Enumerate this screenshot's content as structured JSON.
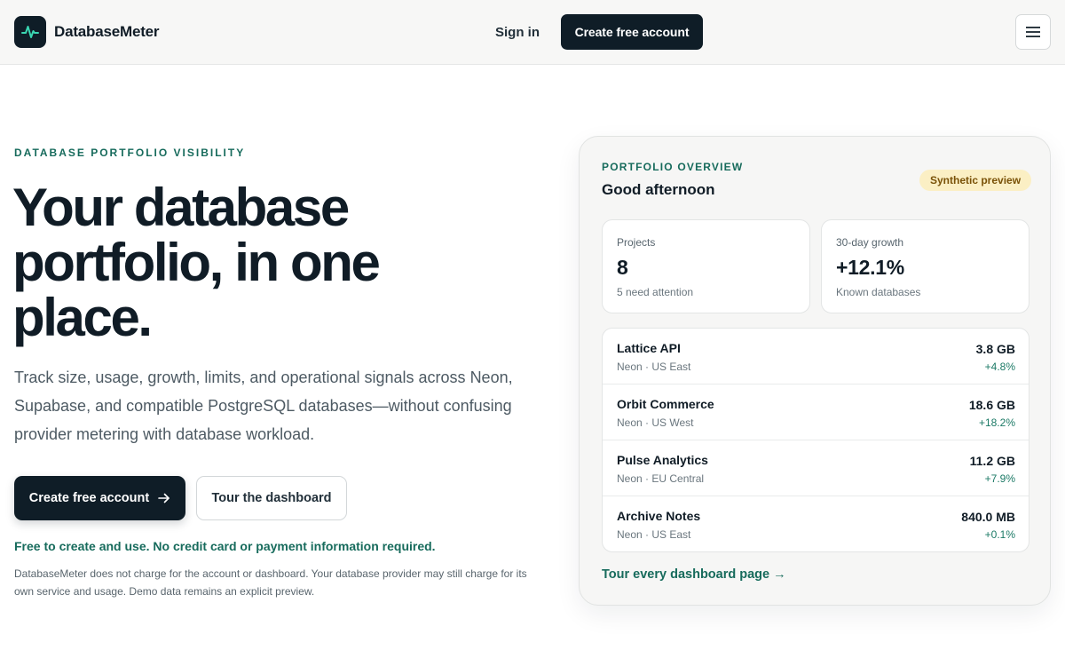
{
  "header": {
    "brand": "DatabaseMeter",
    "logo_icon": "pulse-icon",
    "signin_label": "Sign in",
    "cta_label": "Create free account",
    "menu_icon": "hamburger-icon"
  },
  "hero": {
    "eyebrow": "DATABASE PORTFOLIO VISIBILITY",
    "title": "Your database portfolio, in one place.",
    "description": "Track size, usage, growth, limits, and operational signals across Neon, Supabase, and compatible PostgreSQL databases—without confusing provider metering with database workload.",
    "primary_label": "Create free account",
    "primary_icon": "arrow-right-icon",
    "secondary_label": "Tour the dashboard",
    "free_note": "Free to create and use. No credit card or payment information required.",
    "disclaimer": "DatabaseMeter does not charge for the account or dashboard. Your database provider may still charge for its own service and usage. Demo data remains an explicit preview."
  },
  "card": {
    "eyebrow": "PORTFOLIO OVERVIEW",
    "title": "Good afternoon",
    "badge": "Synthetic preview",
    "stats": [
      {
        "label": "Projects",
        "value": "8",
        "sub": "5 need attention"
      },
      {
        "label": "30-day growth",
        "value": "+12.1%",
        "sub": "Known databases"
      }
    ],
    "databases": [
      {
        "name": "Lattice API",
        "location": "Neon · US East",
        "size": "3.8 GB",
        "growth": "+4.8%"
      },
      {
        "name": "Orbit Commerce",
        "location": "Neon · US West",
        "size": "18.6 GB",
        "growth": "+18.2%"
      },
      {
        "name": "Pulse Analytics",
        "location": "Neon · EU Central",
        "size": "11.2 GB",
        "growth": "+7.9%"
      },
      {
        "name": "Archive Notes",
        "location": "Neon · US East",
        "size": "840.0 MB",
        "growth": "+0.1%"
      }
    ],
    "tour_link": "Tour every dashboard page →"
  },
  "colors": {
    "brand_dark": "#0f1d27",
    "accent_green": "#176b5c",
    "badge_bg": "#fbefc4",
    "badge_text": "#7a5208"
  }
}
